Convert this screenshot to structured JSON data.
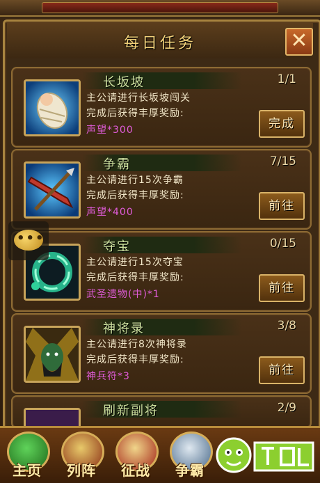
{
  "title": "每日任务",
  "close_symbol": "✕",
  "tasks": [
    {
      "name": "长坂坡",
      "progress": "1/1",
      "desc1": "主公请进行长坂坡闯关",
      "desc2": "完成后获得丰厚奖励:",
      "reward": "声望*300",
      "action": "完成",
      "icon": "baby-swaddle-icon"
    },
    {
      "name": "争霸",
      "progress": "7/15",
      "desc1": "主公请进行15次争霸",
      "desc2": "完成后获得丰厚奖励:",
      "reward": "声望*400",
      "action": "前往",
      "icon": "crossed-weapons-icon"
    },
    {
      "name": "夺宝",
      "progress": "0/15",
      "desc1": "主公请进行15次夺宝",
      "desc2": "完成后获得丰厚奖励:",
      "reward": "武圣遗物(中)*1",
      "action": "前往",
      "icon": "jade-ring-icon"
    },
    {
      "name": "神将录",
      "progress": "3/8",
      "desc1": "主公请进行8次神将录",
      "desc2": "完成后获得丰厚奖励:",
      "reward": "神兵符*3",
      "action": "前往",
      "icon": "general-portrait-icon"
    },
    {
      "name": "刷新副将",
      "progress": "2/9"
    }
  ],
  "nav": [
    {
      "label": "主页",
      "icon": "home-icon"
    },
    {
      "label": "列阵",
      "icon": "formation-icon"
    },
    {
      "label": "征战",
      "icon": "campaign-icon"
    },
    {
      "label": "争霸",
      "icon": "contest-icon"
    }
  ],
  "colors": {
    "title": "#f3d27a",
    "reward": "#e05cd9",
    "name": "#cfe2a0"
  }
}
